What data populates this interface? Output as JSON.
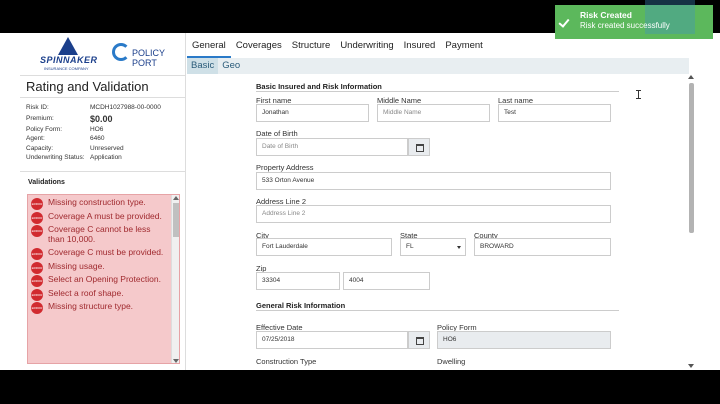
{
  "logos": {
    "spinnaker_name": "SPINNAKER",
    "spinnaker_sub": "INSURANCE COMPANY",
    "policyport_name": "POLICY PORT"
  },
  "panel": {
    "title": "Rating and Validation",
    "risk_id_label": "Risk ID:",
    "risk_id": "MCDH1027988-00-0000",
    "premium_label": "Premium:",
    "premium": "$0.00",
    "policy_form_label": "Policy Form:",
    "policy_form": "HO6",
    "agent_label": "Agent:",
    "agent": "6460",
    "capacity_label": "Capacity:",
    "capacity": "Unreserved",
    "uw_status_label": "Underwriting Status:",
    "uw_status": "Application",
    "validations_label": "Validations",
    "validations": [
      "Missing construction type.",
      "Coverage A must be provided.",
      "Coverage C cannot be less than 10,000.",
      "Coverage C must be provided.",
      "Missing usage.",
      "Select an Opening Protection.",
      "Select a roof shape.",
      "Missing structure type."
    ],
    "error_badge": "ERROR"
  },
  "tabs": [
    "General",
    "Coverages",
    "Structure",
    "Underwriting",
    "Insured",
    "Payment"
  ],
  "subtabs": [
    "Basic",
    "Geo"
  ],
  "form": {
    "section1": "Basic Insured and Risk Information",
    "first_name_label": "First name",
    "first_name": "Jonathan",
    "middle_name_label": "Middle Name",
    "middle_name_ph": "Middle Name",
    "last_name_label": "Last name",
    "last_name": "Test",
    "dob_label": "Date of Birth",
    "dob_ph": "Date of Birth",
    "address_label": "Property Address",
    "address": "533 Orton Avenue",
    "address2_label": "Address Line 2",
    "address2_ph": "Address Line 2",
    "city_label": "City",
    "city": "Fort Lauderdale",
    "state_label": "State",
    "state": "FL",
    "county_label": "County",
    "county": "BROWARD",
    "zip_label": "Zip",
    "zip": "33304",
    "zip4": "4004",
    "section2": "General Risk Information",
    "eff_date_label": "Effective Date",
    "eff_date": "07/25/2018",
    "policy_form_label": "Policy Form",
    "policy_form": "HO6",
    "construction_label": "Construction Type",
    "dwelling_label": "Dwelling"
  },
  "toast": {
    "title": "Risk Created",
    "message": "Risk created successfully"
  },
  "colors": {
    "toast": "#5cb85c",
    "error": "#d12a2f",
    "validation_bg": "#f5c9cb",
    "active_tab": "#2a7ac8"
  }
}
